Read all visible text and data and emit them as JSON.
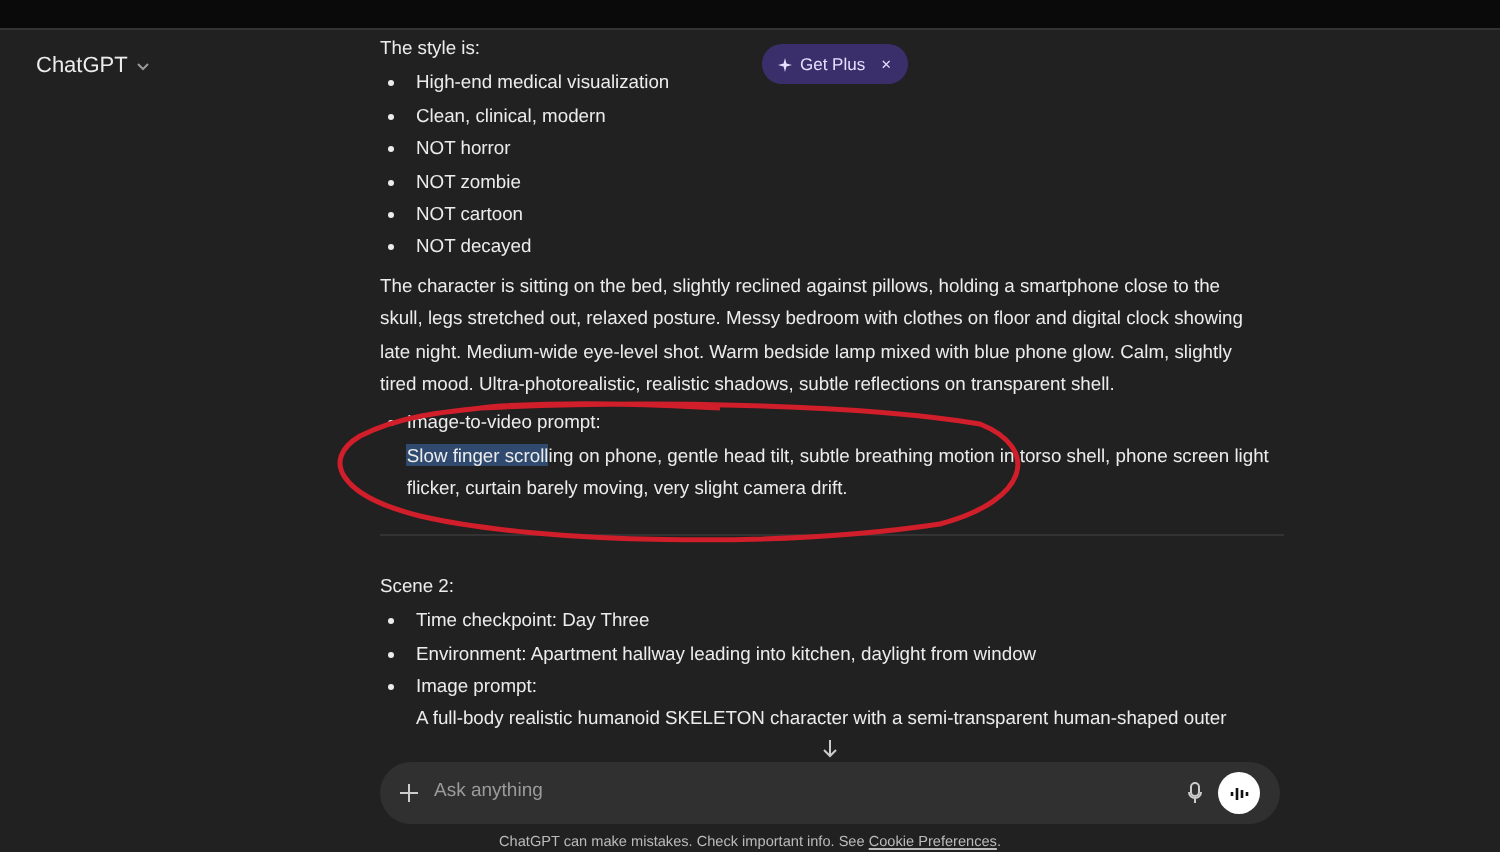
{
  "header": {
    "title": "ChatGPT",
    "upgrade_button": "Get Plus",
    "upgrade_close": "×"
  },
  "message": {
    "intro": "The style is:",
    "style_items": [
      "High-end medical visualization",
      "Clean, clinical, modern",
      "NOT horror",
      "NOT zombie",
      "NOT cartoon",
      "NOT decayed"
    ],
    "paragraph": "The character is sitting on the bed, slightly reclined against pillows, holding a smartphone close to the skull, legs stretched out, relaxed posture. Messy bedroom with clothes on floor and digital clock showing late night. Medium-wide eye-level shot. Warm bedside lamp mixed with blue phone glow. Calm, slightly tired mood. Ultra-photorealistic, realistic shadows, subtle reflections on transparent shell.",
    "video_prompt": {
      "label": "Image-to-video prompt:",
      "selected_text": "Slow finger scroll",
      "text": "ing on phone, gentle head tilt, subtle breathing motion in torso shell, phone screen light flicker, curtain barely moving, very slight camera drift."
    },
    "scene_title": "Scene 2:",
    "scene_items": [
      {
        "text": "Time checkpoint: Day Three"
      },
      {
        "text": "Environment: Apartment hallway leading into kitchen, daylight from window"
      },
      {
        "text": "Image prompt:",
        "detail": "A full-body realistic humanoid SKELETON character with a semi-transparent human-shaped outer"
      }
    ]
  },
  "composer": {
    "placeholder": "Ask anything"
  },
  "footer": {
    "text": "ChatGPT can make mistakes. Check important info. See ",
    "link": "Cookie Preferences",
    "end": "."
  }
}
